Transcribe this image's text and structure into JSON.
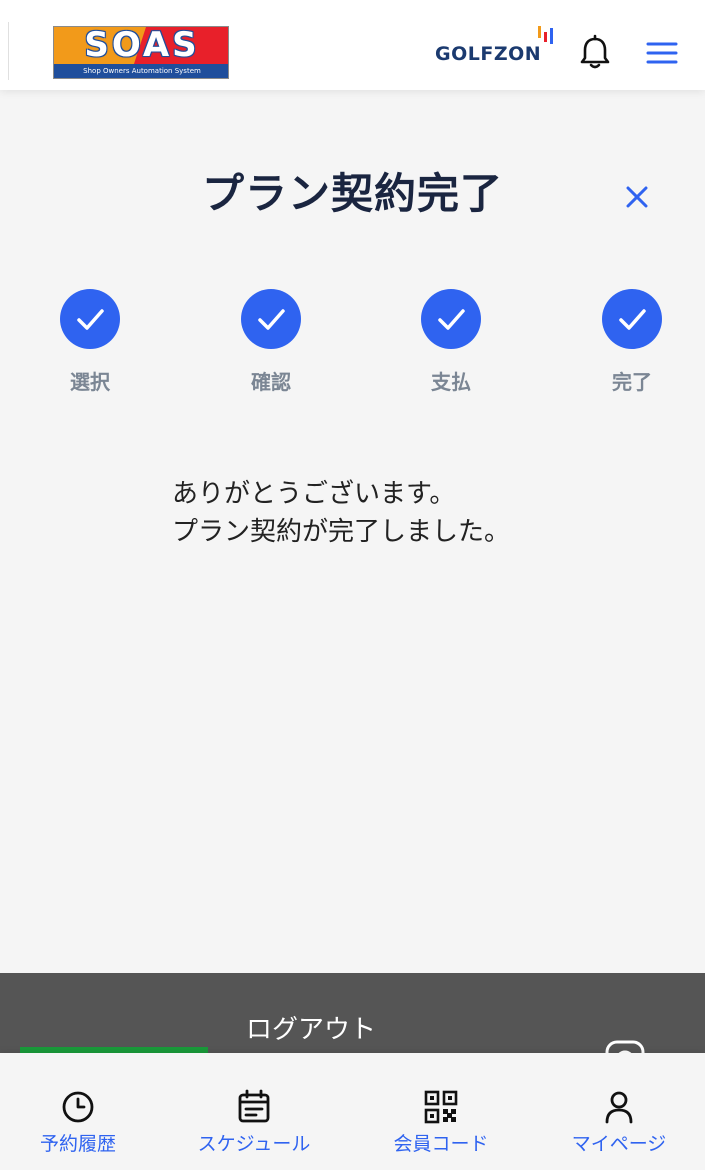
{
  "header": {
    "soas_logo": {
      "text": "SOAS",
      "subtitle": "Shop Owners Automation System",
      "colors": [
        "#f29a1a",
        "#e8202a",
        "#1f4e9c"
      ]
    },
    "golfzon_logo": {
      "text": "GOLFZON",
      "colors": [
        "#1b3a6f",
        "#f29a1a",
        "#e8202a",
        "#2f63f0"
      ]
    },
    "bell_icon": "bell-icon",
    "menu_icon": "hamburger-menu-icon"
  },
  "page": {
    "title": "プラン契約完了",
    "close_icon": "close-icon"
  },
  "steps": [
    {
      "label": "選択",
      "status": "complete"
    },
    {
      "label": "確認",
      "status": "complete"
    },
    {
      "label": "支払",
      "status": "complete"
    },
    {
      "label": "完了",
      "status": "complete"
    }
  ],
  "message": {
    "line1": "ありがとうございます。",
    "line2": "プラン契約が完了しました。"
  },
  "footer": {
    "logout_label": "ログアウト"
  },
  "tabbar": [
    {
      "label": "予約履歴",
      "icon": "clock-icon"
    },
    {
      "label": "スケジュール",
      "icon": "calendar-icon"
    },
    {
      "label": "会員コード",
      "icon": "qr-code-icon"
    },
    {
      "label": "マイページ",
      "icon": "person-icon"
    }
  ],
  "colors": {
    "accent": "#2f63f0",
    "title": "#1a2540",
    "step_label": "#7b8694",
    "footer_bg": "#555555",
    "background": "#f5f5f5"
  }
}
